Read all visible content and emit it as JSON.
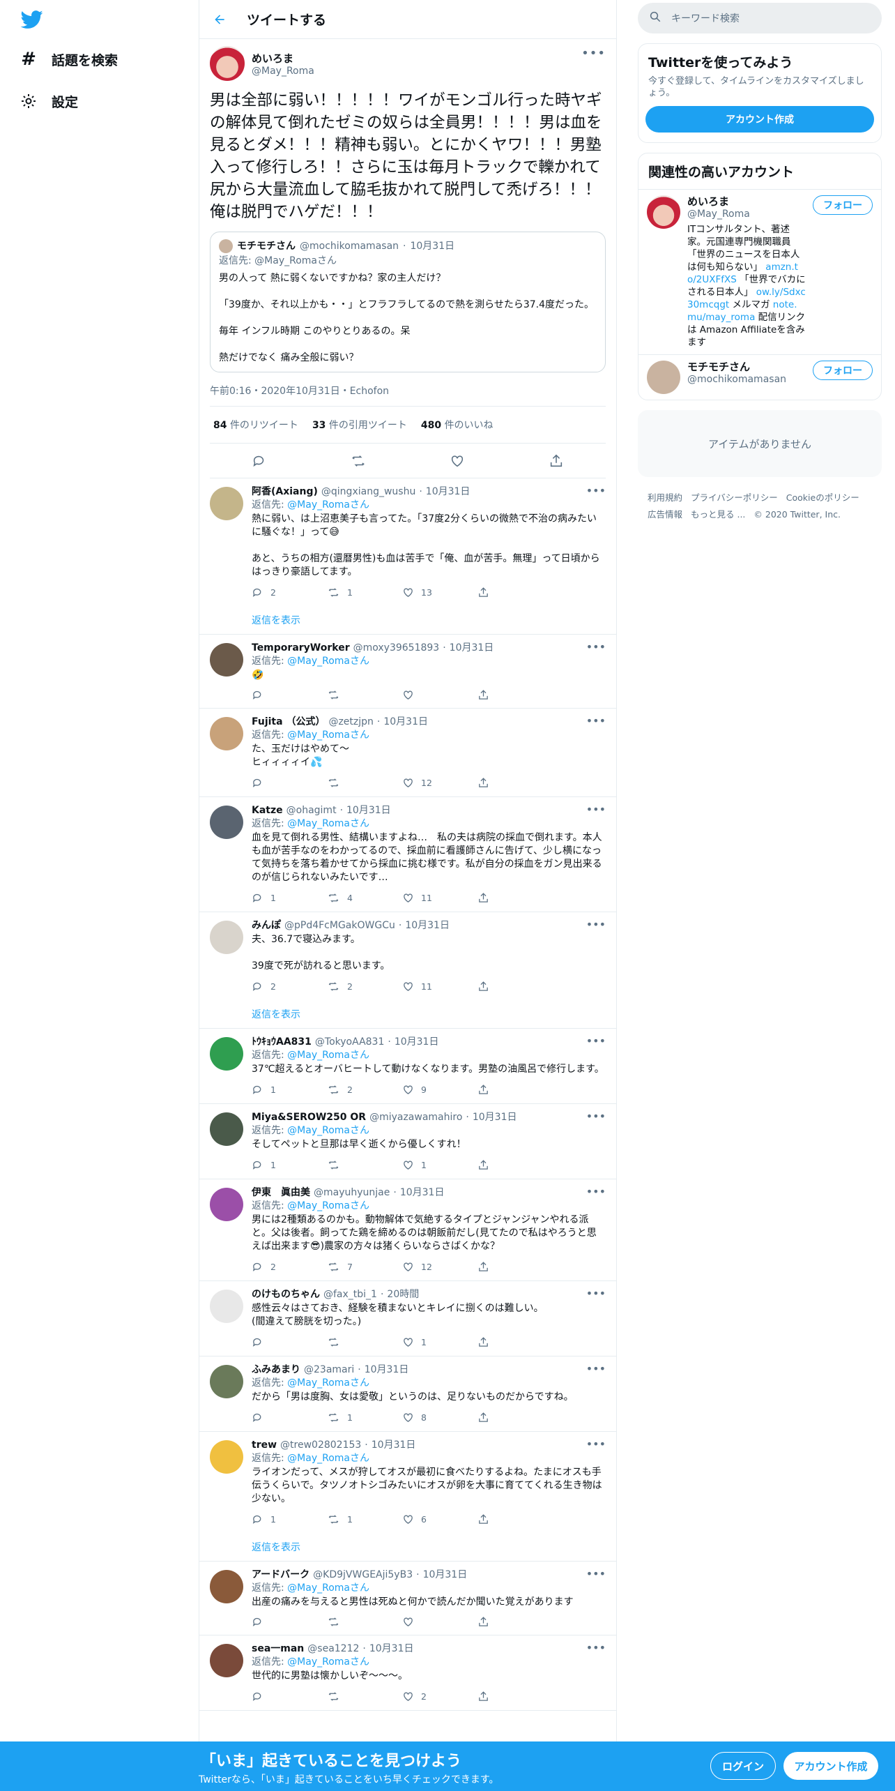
{
  "nav": {
    "explore": "話題を検索",
    "settings": "設定"
  },
  "header": {
    "title": "ツイートする"
  },
  "tweet": {
    "name": "めいろま",
    "handle": "@May_Roma",
    "text": "男は全部に弱い！！！！！ワイがモンゴル行った時ヤギの解体見て倒れたゼミの奴らは全員男！！！！男は血を見るとダメ！！！精神も弱い。とにかくヤワ！！！男塾入って修行しろ！！さらに玉は毎月トラックで轢かれて尻から大量流血して脇毛抜かれて脱門して禿げろ！！！俺は脱門でハゲだ！！！",
    "quote": {
      "name": "モチモチさん",
      "handle": "@mochikomamasan",
      "date": "10月31日",
      "reply_to_label": "返信先: ",
      "reply_to": "@May_Romaさん",
      "text": "男の人って 熱に弱くないですかね？家の主人だけ？\n\n「39度か、それ以上かも・・」とフラフラしてるので熱を測らせたら37.4度だった。\n\n毎年 インフル時期 このやりとりあるの。呆\n\n熱だけでなく 痛み全般に弱い？"
    },
    "meta": "午前0:16・2020年10月31日・Echofon",
    "stats": {
      "retweets": "84",
      "retweets_label": "件のリツイート",
      "quotes": "33",
      "quotes_label": "件の引用ツイート",
      "likes": "480",
      "likes_label": "件のいいね"
    }
  },
  "replies": [
    {
      "name": "阿香(Axiang)",
      "handle": "@qingxiang_wushu",
      "date": "10月31日",
      "reply_to": "@May_Romaさん",
      "text": "熱に弱い、は上沼恵美子も言ってた。「37度2分くらいの微熱で不治の病みたいに騒ぐな！」って😅\n\nあと、うちの相方(還暦男性)も血は苦手で「俺、血が苦手。無理」って日頃からはっきり豪語してます。",
      "replies": "2",
      "rts": "1",
      "likes": "13",
      "show_more": "返信を表示",
      "color": "#c4b58a"
    },
    {
      "name": "TemporaryWorker",
      "handle": "@moxy39651893",
      "date": "10月31日",
      "reply_to": "@May_Romaさん",
      "text": "🤣",
      "replies": "",
      "rts": "",
      "likes": "",
      "color": "#6b5a4a"
    },
    {
      "name": "Fujita （公式）",
      "handle": "@zetzjpn",
      "date": "10月31日",
      "reply_to": "@May_Romaさん",
      "text": "た、玉だけはやめて〜\nヒィィィィイ💦",
      "replies": "",
      "rts": "",
      "likes": "12",
      "color": "#c8a27a"
    },
    {
      "name": "Katze",
      "handle": "@ohagimt",
      "date": "10月31日",
      "reply_to": "@May_Romaさん",
      "text": "血を見て倒れる男性、結構いますよね…　私の夫は病院の採血で倒れます。本人も血が苦手なのをわかってるので、採血前に看護師さんに告げて、少し横になって気持ちを落ち着かせてから採血に挑む様です。私が自分の採血をガン見出来るのが信じられないみたいです…",
      "replies": "1",
      "rts": "4",
      "likes": "11",
      "color": "#5a6470"
    },
    {
      "name": "みんぽ",
      "handle": "@pPd4FcMGakOWGCu",
      "date": "10月31日",
      "reply_to": "",
      "text": "夫、36.7で寝込みます。\n\n39度で死が訪れると思います。",
      "replies": "2",
      "rts": "2",
      "likes": "11",
      "show_more": "返信を表示",
      "color": "#d9d4cc"
    },
    {
      "name": "ﾄｳｷｮｳAA831",
      "handle": "@TokyoAA831",
      "date": "10月31日",
      "reply_to": "@May_Romaさん",
      "text": "37℃超えるとオーバヒートして動けなくなります。男塾の油風呂で修行します。",
      "replies": "1",
      "rts": "2",
      "likes": "9",
      "color": "#2f9e50"
    },
    {
      "name": "Miya&SEROW250 OR",
      "handle": "@miyazawamahiro",
      "date": "10月31日",
      "reply_to": "@May_Romaさん",
      "text": "そしてペットと旦那は早く逝くから優しくすれ！",
      "replies": "1",
      "rts": "",
      "likes": "1",
      "color": "#4a5a4a"
    },
    {
      "name": "伊東　眞由美",
      "handle": "@mayuhyunjae",
      "date": "10月31日",
      "reply_to": "@May_Romaさん",
      "text": "男には2種類あるのかも。動物解体で気絶するタイプとジャンジャンやれる派と。父は後者。飼ってた鶏を締めるのは朝飯前だし(見てたので私はやろうと思えば出来ます😎)農家の方々は猪くらいならさばくかな？",
      "replies": "2",
      "rts": "7",
      "likes": "12",
      "color": "#9b4fa8"
    },
    {
      "name": "のけものちゃん",
      "handle": "@fax_tbi_1",
      "date": "20時間",
      "reply_to": "",
      "text": "感性云々はさておき、経験を積まないとキレイに捌くのは難しい。\n(間違えて膀胱を切った。)",
      "replies": "",
      "rts": "",
      "likes": "1",
      "color": "#e8e8e8"
    },
    {
      "name": "ふみあまり",
      "handle": "@23amari",
      "date": "10月31日",
      "reply_to": "@May_Romaさん",
      "text": "だから「男は度胸、女は愛敬」というのは、足りないものだからですね。",
      "replies": "",
      "rts": "1",
      "likes": "8",
      "color": "#6a7a5a"
    },
    {
      "name": "trew",
      "handle": "@trew02802153",
      "date": "10月31日",
      "reply_to": "@May_Romaさん",
      "text": "ライオンだって、メスが狩してオスが最初に食べたりするよね。たまにオスも手伝うくらいで。タツノオトシゴみたいにオスが卵を大事に育ててくれる生き物は少ない。",
      "replies": "1",
      "rts": "1",
      "likes": "6",
      "show_more": "返信を表示",
      "color": "#f0c040"
    },
    {
      "name": "アードバーク",
      "handle": "@KD9jVWGEAji5yB3",
      "date": "10月31日",
      "reply_to": "@May_Romaさん",
      "text": "出産の痛みを与えると男性は死ぬと何かで読んだか聞いた覚えがあります",
      "replies": "",
      "rts": "",
      "likes": "",
      "color": "#8a5a3a"
    },
    {
      "name": "sea一man",
      "handle": "@sea1212",
      "date": "10月31日",
      "reply_to": "@May_Romaさん",
      "text": "世代的に男塾は懐かしいぞ〜〜〜。",
      "replies": "",
      "rts": "",
      "likes": "2",
      "color": "#7a4a3a"
    }
  ],
  "reply_to_label": "返信先: ",
  "right": {
    "search_placeholder": "キーワード検索",
    "try_title": "Twitterを使ってみよう",
    "try_sub": "今すぐ登録して、タイムラインをカスタマイズしましょう。",
    "create_account": "アカウント作成",
    "related_title": "関連性の高いアカウント",
    "accounts": [
      {
        "name": "めいろま",
        "handle": "@May_Roma",
        "follow": "フォロー",
        "bio_1": "ITコンサルタント、著述家。元国連専門機関職員「世界のニュースを日本人は何も知らない」",
        "link_1": "amzn.to/2UXFfXS",
        "bio_2": "「世界でバカにされる日本人」",
        "link_2": "ow.ly/Sdxc30mcqgt",
        "bio_3": " メルマガ ",
        "link_3": "note.mu/may_roma",
        "bio_4": " 配信リンクは Amazon Affiliateを含みます"
      },
      {
        "name": "モチモチさん",
        "handle": "@mochikomamasan",
        "follow": "フォロー"
      }
    ],
    "empty": "アイテムがありません",
    "footer": [
      "利用規約",
      "プライバシーポリシー",
      "Cookieのポリシー",
      "広告情報",
      "もっと見る ...",
      "© 2020 Twitter, Inc."
    ]
  },
  "bottom": {
    "title": "「いま」起きていることを見つけよう",
    "sub": "Twitterなら、「いま」起きていることをいち早くチェックできます。",
    "login": "ログイン",
    "signup": "アカウント作成"
  },
  "colors": {
    "accent": "#1da1f2",
    "muted": "#5b7083",
    "border": "#e6ecf0"
  }
}
